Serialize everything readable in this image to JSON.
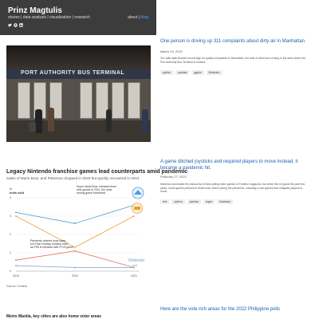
{
  "header": {
    "title": "Prinz Magtulis",
    "subtitle": "stories | data analysis | visualization | research",
    "about_label": "about | ",
    "about_link": "blog",
    "icons": [
      "twitter-icon",
      "github-icon",
      "linkedin-icon"
    ]
  },
  "posts": [
    {
      "title": "One person is driving up 311 complaints about dirty air in Manhattan",
      "date": "March 16, 2022",
      "body": "311 calls data showed record high air quality complaints in Manhattan, the bulk of which are coming in the area where the Port Authority Bus Terminal is located.",
      "tags": [
        "python",
        "pandas",
        "ggplot",
        "Illustrator"
      ],
      "image_sign": "PORT AUTHORITY BUS TERMINAL"
    },
    {
      "title": "A game ditched joysticks and required players to move instead, it became a pandemic hit.",
      "date": "February 27, 2022",
      "body": "Nintendo dominates the annual list of best-selling video games of Famitsu magazine, but while this is typical the past few years, some games performed better than others during the pandemic, including a new games that mitigates players to move.",
      "tags": [
        "text",
        "python",
        "pandas",
        "regex",
        "Illustrator"
      ]
    },
    {
      "title": "Here are the vote-rich areas for the 2022 Philippine polls"
    }
  ],
  "chart": {
    "title": "Legacy Nintendo franchise games lead counterparts amid pandemic",
    "subtitle": "Sales of Mario Bros. and Pokemon dropped in 2020 but quickly recovered in 2021",
    "unit_label_1": "In",
    "unit_label_2": "units sold",
    "annotation_top_1": "Super Mario Bros. released three",
    "annotation_top_2": "new games in 2021, the most",
    "annotation_top_3": "among game franchises",
    "annotation_bottom_1": "Pandemic desired most sales",
    "annotation_bottom_2": "but Final Fantasy tumbled hard",
    "annotation_bottom_3": "as PS5 is released with FFVII game",
    "badge_text": "Nintendo",
    "badge_sub": "evil",
    "source": "Source: Famitsu"
  },
  "chart_data": {
    "type": "line",
    "x": [
      "2019",
      "2020",
      "2021"
    ],
    "yticks": [
      0,
      1,
      2,
      3,
      4
    ],
    "ylim": [
      0,
      4
    ],
    "series": [
      {
        "values": [
          3.2,
          2.6,
          3.6
        ],
        "color": "#4a9fd5"
      },
      {
        "values": [
          3.0,
          1.3,
          3.0
        ],
        "color": "#e8a033"
      },
      {
        "values": [
          0.6,
          1.1,
          0.2
        ],
        "color": "#e2775b"
      },
      {
        "values": [
          0.3,
          0.2,
          0.2
        ],
        "color": "#7aa0c8"
      }
    ]
  },
  "next_section_title": "Metro Manila, key cities are also home voter areas"
}
